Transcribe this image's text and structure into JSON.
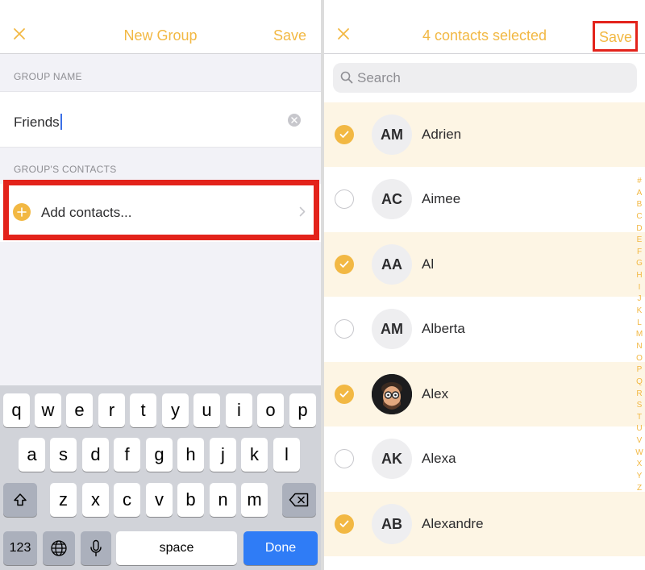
{
  "left": {
    "nav": {
      "title": "New Group",
      "save_label": "Save"
    },
    "group_name": {
      "section_label": "GROUP NAME",
      "value": "Friends"
    },
    "contacts": {
      "section_label": "GROUP'S CONTACTS",
      "add_label": "Add contacts..."
    },
    "keyboard": {
      "row1": [
        "q",
        "w",
        "e",
        "r",
        "t",
        "y",
        "u",
        "i",
        "o",
        "p"
      ],
      "row2": [
        "a",
        "s",
        "d",
        "f",
        "g",
        "h",
        "j",
        "k",
        "l"
      ],
      "row3": [
        "z",
        "x",
        "c",
        "v",
        "b",
        "n",
        "m"
      ],
      "numbers_label": "123",
      "space_label": "space",
      "done_label": "Done"
    }
  },
  "right": {
    "nav": {
      "title": "4 contacts selected",
      "save_label": "Save"
    },
    "search": {
      "placeholder": "Search"
    },
    "contacts": [
      {
        "initials": "AM",
        "name": "Adrien",
        "selected": true
      },
      {
        "initials": "AC",
        "name": "Aimee",
        "selected": false
      },
      {
        "initials": "AA",
        "name": "Al",
        "selected": true
      },
      {
        "initials": "AM",
        "name": "Alberta",
        "selected": false
      },
      {
        "initials": "",
        "name": "Alex",
        "selected": true,
        "photo": true
      },
      {
        "initials": "AK",
        "name": "Alexa",
        "selected": false
      },
      {
        "initials": "AB",
        "name": "Alexandre",
        "selected": true
      }
    ],
    "index_letters": [
      "#",
      "A",
      "B",
      "C",
      "D",
      "E",
      "F",
      "G",
      "H",
      "I",
      "J",
      "K",
      "L",
      "M",
      "N",
      "O",
      "P",
      "Q",
      "R",
      "S",
      "T",
      "U",
      "V",
      "W",
      "X",
      "Y",
      "Z"
    ]
  },
  "colors": {
    "accent": "#f2b843",
    "highlight": "#e3231b",
    "selected_row": "#fdf5e4",
    "done_key": "#2f7cf6"
  }
}
